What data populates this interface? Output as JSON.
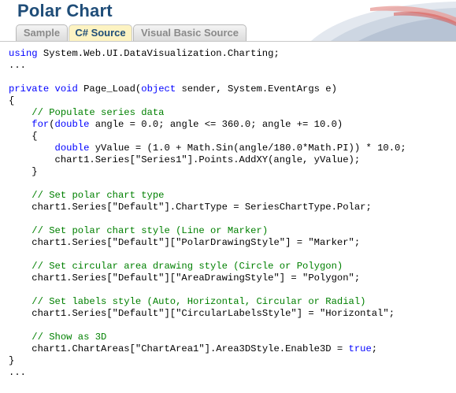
{
  "page": {
    "title": "Polar Chart"
  },
  "tabs": [
    {
      "label": "Sample",
      "active": false
    },
    {
      "label": "C# Source",
      "active": true
    },
    {
      "label": "Visual Basic Source",
      "active": false
    }
  ],
  "colors": {
    "title": "#1f4d78",
    "keyword": "#0000ff",
    "comment": "#008000",
    "active_tab": "#fdf3c2",
    "accent_red": "#d9534f"
  },
  "code": {
    "line01": {
      "keyword": "using",
      "text": " System.Web.UI.DataVisualization.Charting;"
    },
    "line02": "...",
    "line04": {
      "keyword": "private",
      "keyword2": "void",
      "text_a": " Page_Load(",
      "keyword3": "object",
      "text_b": " sender, System.EventArgs e)"
    },
    "line05": "{",
    "line06": "// Populate series data",
    "line07": {
      "keyword": "for",
      "keyword2": "double",
      "text": " angle = 0.0; angle <= 360.0; angle += 10.0)"
    },
    "line08": "{",
    "line09": {
      "keyword": "double",
      "text": " yValue = (1.0 + Math.Sin(angle/180.0*Math.PI)) * 10.0;"
    },
    "line10": "chart1.Series[\"Series1\"].Points.AddXY(angle, yValue);",
    "line11": "}",
    "line13": "// Set polar chart type",
    "line14": "chart1.Series[\"Default\"].ChartType = SeriesChartType.Polar;",
    "line16": "// Set polar chart style (Line or Marker)",
    "line17": "chart1.Series[\"Default\"][\"PolarDrawingStyle\"] = \"Marker\";",
    "line19": "// Set circular area drawing style (Circle or Polygon)",
    "line20": "chart1.Series[\"Default\"][\"AreaDrawingStyle\"] = \"Polygon\";",
    "line22": "// Set labels style (Auto, Horizontal, Circular or Radial)",
    "line23": "chart1.Series[\"Default\"][\"CircularLabelsStyle\"] = \"Horizontal\";",
    "line25": "// Show as 3D",
    "line26": {
      "text": "chart1.ChartAreas[\"ChartArea1\"].Area3DStyle.Enable3D = ",
      "keyword": "true",
      "tail": ";"
    },
    "line27": "}",
    "line28": "..."
  }
}
